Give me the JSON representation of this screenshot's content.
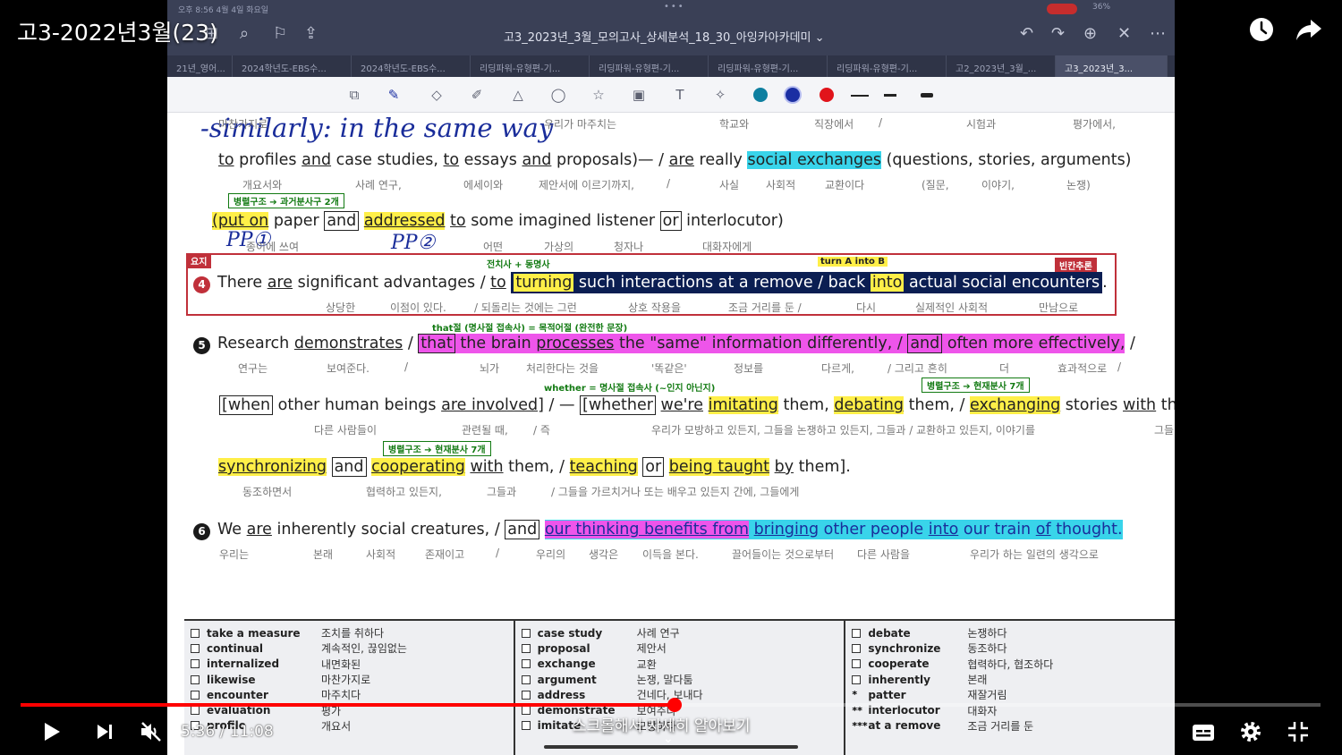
{
  "video": {
    "title": "고3-2022년3월(23)",
    "current_time": "5:36",
    "duration": "11:08",
    "separator": " / ",
    "progress_fraction": 0.503,
    "hint": "스크롤해서 자세히 알아보기"
  },
  "ipad": {
    "status_left": "오후 8:56   4월 4일 화요일",
    "battery": "36%",
    "doc_title": "고3_2023년_3월_모의고사_상세분석_18_30_아잉카아카데미 ⌄",
    "tabs": [
      "21년_영어...",
      "2024학년도-EBS수...",
      "2024학년도-EBS수...",
      "리딩파워-유형편-기...",
      "리딩파워-유형편-기...",
      "리딩파워-유형편-기...",
      "리딩파워-유형편-기...",
      "고2_2023년_3월_...",
      "고3_2023년_3..."
    ]
  },
  "colors": {
    "accent_red": "#ff0000",
    "highlight_cyan": "#39d4ea",
    "highlight_yellow": "#ffef48",
    "highlight_pink": "#ee55ea",
    "pen_blue": "#1a2d9a",
    "box_red": "#c0303a"
  },
  "icons": {
    "toolbar": [
      "lasso-icon",
      "pen-icon",
      "eraser-icon",
      "highlighter-icon",
      "shapes-icon",
      "lasso-select-icon",
      "sticker-icon",
      "image-icon",
      "text-icon",
      "laser-pointer-icon"
    ],
    "pen_colors": [
      "#0e7fa0",
      "#1b2fa3",
      "#e1141b"
    ]
  },
  "doc": {
    "handwriting": {
      "similarly": "-similarly: in the same way",
      "pp1": "PP①",
      "pp2": "PP②"
    },
    "line1": {
      "w1": "to",
      "w2": "profiles",
      "w3": "and",
      "w4": "case studies,",
      "w5": "to",
      "w6": "essays",
      "w7": "and",
      "w8": "proposals)—",
      "w9": "/",
      "w10": "are",
      "w11": "really",
      "w12": "social exchanges",
      "w13": "(questions, stories, arguments)"
    },
    "line1_ko_top": {
      "a": "마찬가지로",
      "b": "우리가  마주치는",
      "c": "학교와",
      "d": "직장에서",
      "e": "/",
      "f": "시험과",
      "g": "평가에서,"
    },
    "line1_ko": {
      "a": "개요서와",
      "b": "사례 연구,",
      "c": "에세이와",
      "d": "제안서에 이르기까지,",
      "e": "/",
      "f": "사실",
      "g": "사회적",
      "h": "교환이다",
      "i": "(질문,",
      "j": "이야기,",
      "k": "논쟁)"
    },
    "label_parallel_past": "병렬구조 ➔ 과거분사구 2개",
    "line2": {
      "w1": "(put on",
      "w2": "paper",
      "w3": "and",
      "w4": "addressed",
      "w5": "to",
      "w6": "some imagined listener",
      "w7": "or",
      "w8": "interlocutor)"
    },
    "line2_ko": {
      "a": "종이에 쓰여",
      "b": "어떤",
      "c": "가상의",
      "d": "청자나",
      "e": "대화자에게"
    },
    "main_tag": "요지",
    "label_prep_gerund": "전치사 + 동명사",
    "label_turn": "turn A into B",
    "tag_blank": "빈칸추론",
    "s4": {
      "num": "4",
      "w1": "There",
      "w2": "are",
      "w3": "significant advantages",
      "w4": "/",
      "w5": "to",
      "w6": "turning",
      "w7": "such interactions at a remove",
      "w8": "/",
      "w9": "back",
      "w10": "into",
      "w11": "actual social encounters",
      "w12": "."
    },
    "s4_ko": {
      "a": "상당한",
      "b": "이점이 있다.",
      "c": "/ 되돌리는 것에는 그런",
      "d": "상호 작용을",
      "e": "조금 거리를 둔 /",
      "f": "다시",
      "g": "실제적인 사회적",
      "h": "만남으로"
    },
    "label_that": "that절 (명사절 접속사) = 목적어절 (완전한 문장)",
    "s5": {
      "num": "5",
      "w1": "Research",
      "w2": "demonstrates",
      "w3": "/",
      "w4": "that",
      "w5": "the brain",
      "w6": "processes",
      "w7": "the \"same\" information differently,",
      "w8": "/",
      "w9": "and",
      "w10": "often more effectively,",
      "w11": "/"
    },
    "s5_ko": {
      "a": "연구는",
      "b": "보여준다.",
      "c": "/",
      "d": "뇌가",
      "e": "처리한다는 것을",
      "f": "'똑같은'",
      "g": "정보를",
      "h": "다르게,",
      "i": "/ 그리고 흔히",
      "j": "더",
      "k": "효과적으로",
      "l": "/"
    },
    "label_whether": "whether = 명사절 접속사 (~인지 아닌지)",
    "label_parallel_present1": "병렬구조 ➔ 현재분사 7개",
    "s5b": {
      "w1": "[when",
      "w2": "other human beings",
      "w3": "are involved]",
      "w4": "/ —",
      "w5": "[whether",
      "w6": "we're",
      "w7": "imitating",
      "w8": "them,",
      "w9": "debating",
      "w10": "them,",
      "w11": "/",
      "w12": "exchanging",
      "w13": "stories",
      "w14": "with",
      "w15": "them,"
    },
    "s5b_ko": {
      "a": "다른 사람들이",
      "b": "관련될 때,",
      "c": "/ 즉",
      "d": "우리가 모방하고 있든지, 그들을 논쟁하고 있든지, 그들과 / 교환하고 있든지, 이야기를",
      "e": "그들"
    },
    "label_parallel_present2": "병렬구조 ➔ 현재분사 7개",
    "s5c": {
      "w1": "synchronizing",
      "w2": "and",
      "w3": "cooperating",
      "w4": "with",
      "w5": "them,",
      "w6": "/",
      "w7": "teaching",
      "w8": "or",
      "w9": "being taught",
      "w10": "by",
      "w11": "them]",
      "w12": "."
    },
    "s5c_ko": {
      "a": "동조하면서",
      "b": "협력하고 있든지,",
      "c": "그들과",
      "d": "/ 그들을 가르치거나 또는 배우고 있든지 간에, 그들에게"
    },
    "s6": {
      "num": "6",
      "w1": "We",
      "w2": "are",
      "w3": "inherently social creatures,",
      "w4": "/",
      "w5": "and",
      "w6": "our thinking benefits from",
      "w7": "bringing",
      "w8": "other people",
      "w9": "into",
      "w10": "our train",
      "w11": "of",
      "w12": "thought."
    },
    "s6_ko": {
      "a": "우리는",
      "b": "본래",
      "c": "사회적",
      "d": "존재이고",
      "e": "/",
      "f": "우리의",
      "g": "생각은",
      "h": "이득을 본다.",
      "i": "끌어들이는 것으로부터",
      "j": "다른 사람을",
      "k": "우리가 하는 일련의 생각으로"
    }
  },
  "vocab": [
    [
      {
        "mark": "",
        "word": "take a measure",
        "meaning": "조치를 취하다"
      },
      {
        "mark": "",
        "word": "continual",
        "meaning": "계속적인, 끊임없는"
      },
      {
        "mark": "",
        "word": "internalized",
        "meaning": "내면화된"
      },
      {
        "mark": "",
        "word": "likewise",
        "meaning": "마찬가지로"
      },
      {
        "mark": "",
        "word": "encounter",
        "meaning": "마주치다"
      },
      {
        "mark": "",
        "word": "evaluation",
        "meaning": "평가"
      },
      {
        "mark": "",
        "word": "profile",
        "meaning": "개요서"
      }
    ],
    [
      {
        "mark": "",
        "word": "case study",
        "meaning": "사례 연구"
      },
      {
        "mark": "",
        "word": "proposal",
        "meaning": "제안서"
      },
      {
        "mark": "",
        "word": "exchange",
        "meaning": "교환"
      },
      {
        "mark": "",
        "word": "argument",
        "meaning": "논쟁, 말다툼"
      },
      {
        "mark": "",
        "word": "address",
        "meaning": "건네다, 보내다"
      },
      {
        "mark": "",
        "word": "demonstrate",
        "meaning": "보여주다"
      },
      {
        "mark": "",
        "word": "imitate",
        "meaning": "모방하다"
      }
    ],
    [
      {
        "mark": "",
        "word": "debate",
        "meaning": "논쟁하다"
      },
      {
        "mark": "",
        "word": "synchronize",
        "meaning": "동조하다"
      },
      {
        "mark": "",
        "word": "cooperate",
        "meaning": "협력하다, 협조하다"
      },
      {
        "mark": "",
        "word": "inherently",
        "meaning": "본래"
      },
      {
        "mark": "*",
        "word": "patter",
        "meaning": "재잘거림"
      },
      {
        "mark": "**",
        "word": "interlocutor",
        "meaning": "대화자"
      },
      {
        "mark": "***",
        "word": "at a remove",
        "meaning": "조금 거리를 둔"
      }
    ]
  ]
}
